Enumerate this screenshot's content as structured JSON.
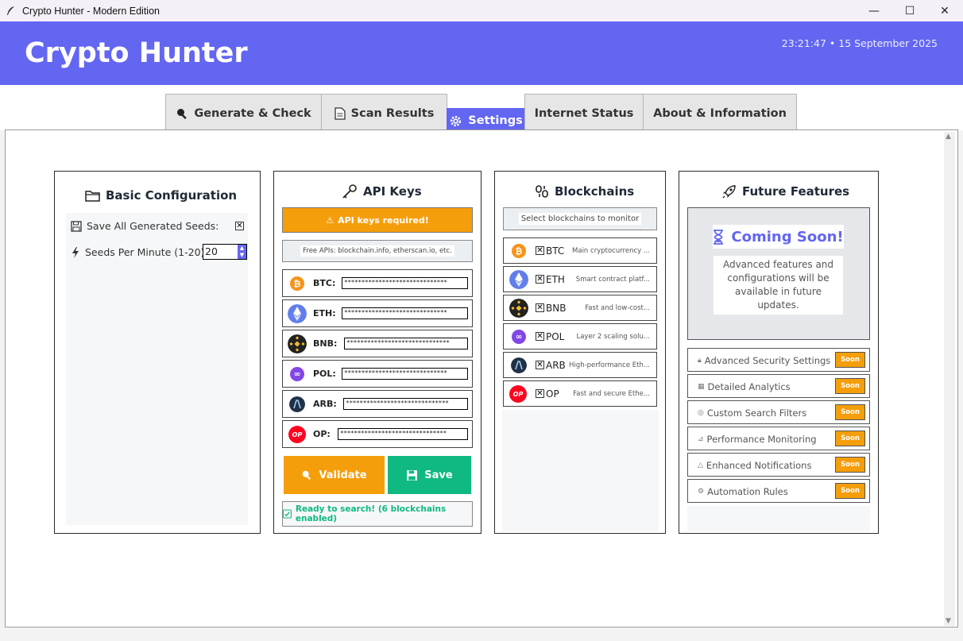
{
  "window": {
    "title": "Crypto Hunter - Modern Edition",
    "minimize": "—",
    "maximize": "☐",
    "close": "✕"
  },
  "header": {
    "title": "Crypto Hunter",
    "clock": "23:21:47 • 15 September 2025",
    "accent_color": "#6366f1"
  },
  "tabs": [
    {
      "label": "Generate & Check",
      "icon": "magnifier-icon",
      "active": false
    },
    {
      "label": "Scan Results",
      "icon": "document-icon",
      "active": false
    },
    {
      "label": "Settings",
      "icon": "gear-icon",
      "active": true
    },
    {
      "label": "Internet Status",
      "icon": "",
      "active": false
    },
    {
      "label": "About & Information",
      "icon": "",
      "active": false
    }
  ],
  "basic_config": {
    "title": "Basic Configuration",
    "save_seeds_label": "Save All Generated Seeds:",
    "save_seeds_checked": "✕",
    "seeds_per_minute_label": "Seeds Per Minute (1-20):",
    "seeds_per_minute_value": "20"
  },
  "api_keys": {
    "title": "API Keys",
    "warning": "API keys required!",
    "hint": "Free APIs: blockchain.info, etherscan.io, etc.",
    "keys": [
      {
        "label": "BTC:",
        "value": "******************************",
        "color": "#f7931a"
      },
      {
        "label": "ETH:",
        "value": "******************************",
        "color": "#627eea"
      },
      {
        "label": "BNB:",
        "value": "******************************",
        "color": "#f3ba2f"
      },
      {
        "label": "POL:",
        "value": "******************************",
        "color": "#8247e5"
      },
      {
        "label": "ARB:",
        "value": "******************************",
        "color": "#213147"
      },
      {
        "label": "OP:",
        "value": "*******************************",
        "color": "#ff0420"
      }
    ],
    "validate_label": "Validate",
    "save_label": "Save",
    "validate_color": "#f59e0b",
    "save_color": "#10b981",
    "status": "Ready to search! (6 blockchains enabled)"
  },
  "blockchains": {
    "title": "Blockchains",
    "hint": "Select blockchains to monitor",
    "chains": [
      {
        "symbol": "BTC",
        "checked": "✕",
        "desc": "Main cryptocurrency ..."
      },
      {
        "symbol": "ETH",
        "checked": "✕",
        "desc": "Smart contract platf..."
      },
      {
        "symbol": "BNB",
        "checked": "✕",
        "desc": "Fast and low-cost..."
      },
      {
        "symbol": "POL",
        "checked": "✕",
        "desc": "Layer 2 scaling solu..."
      },
      {
        "symbol": "ARB",
        "checked": "✕",
        "desc": "High-performance Eth..."
      },
      {
        "symbol": "OP",
        "checked": "✕",
        "desc": "Fast and secure Ethe..."
      }
    ]
  },
  "future": {
    "title": "Future Features",
    "coming_soon": "Coming Soon!",
    "description": "Advanced features and configurations will be available in future updates.",
    "soon_label": "Soon",
    "features": [
      {
        "label": "Advanced Security Settings",
        "icon": "lock-icon"
      },
      {
        "label": "Detailed Analytics",
        "icon": "chart-icon"
      },
      {
        "label": "Custom Search Filters",
        "icon": "target-icon"
      },
      {
        "label": "Performance Monitoring",
        "icon": "graph-icon"
      },
      {
        "label": "Enhanced Notifications",
        "icon": "bell-icon"
      },
      {
        "label": "Automation Rules",
        "icon": "gear-icon"
      }
    ]
  },
  "coin_text": {
    "op": "OP"
  }
}
